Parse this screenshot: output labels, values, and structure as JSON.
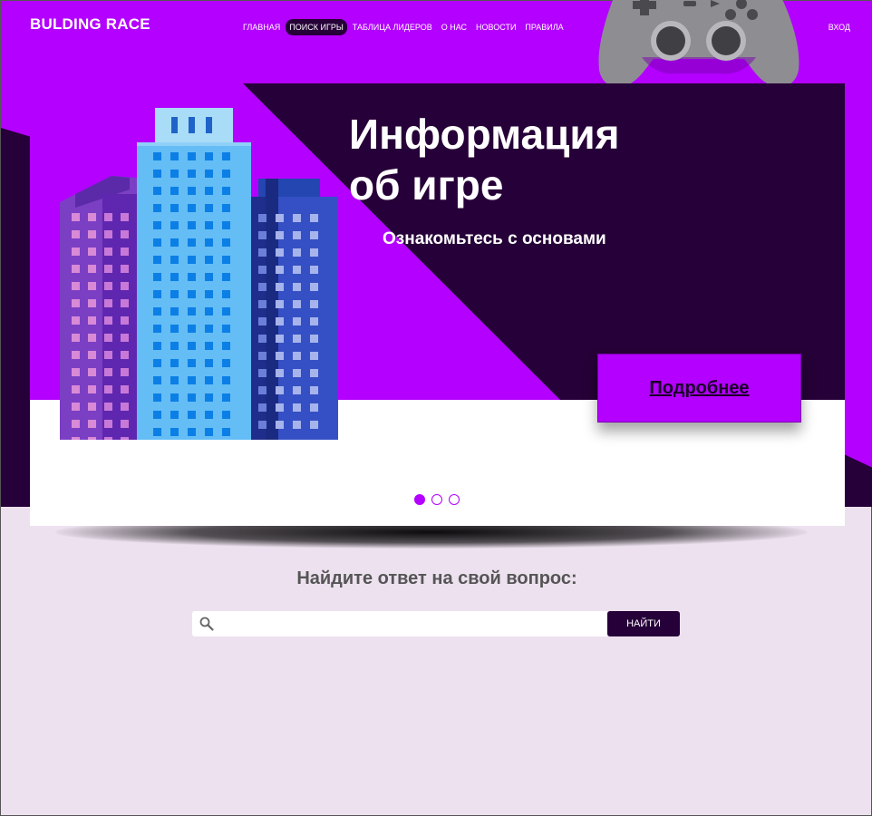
{
  "header": {
    "logo": "BULDING RACE",
    "nav": [
      {
        "label": "ГЛАВНАЯ",
        "active": false
      },
      {
        "label": "ПОИСК ИГРЫ",
        "active": true
      },
      {
        "label": "ТАБЛИЦА ЛИДЕРОВ",
        "active": false
      },
      {
        "label": "О НАС",
        "active": false
      },
      {
        "label": "НОВОСТИ",
        "active": false
      },
      {
        "label": "ПРАВИЛА",
        "active": false
      }
    ],
    "login": "ВХОД"
  },
  "hero": {
    "title": "Информация\nоб игре",
    "subtitle": "Ознакомьтесь с основами",
    "button": "Подробнее",
    "slides_count": 3,
    "active_slide": 1
  },
  "faq": {
    "title": "Найдите ответ на свой вопрос:",
    "search_placeholder": "",
    "search_value": "",
    "button": "НАЙТИ"
  },
  "colors": {
    "accent": "#b300ff",
    "dark": "#260038",
    "page_bg": "#ede1ef"
  },
  "icons": [
    "gamepad-icon",
    "building-illustration",
    "search-icon"
  ]
}
